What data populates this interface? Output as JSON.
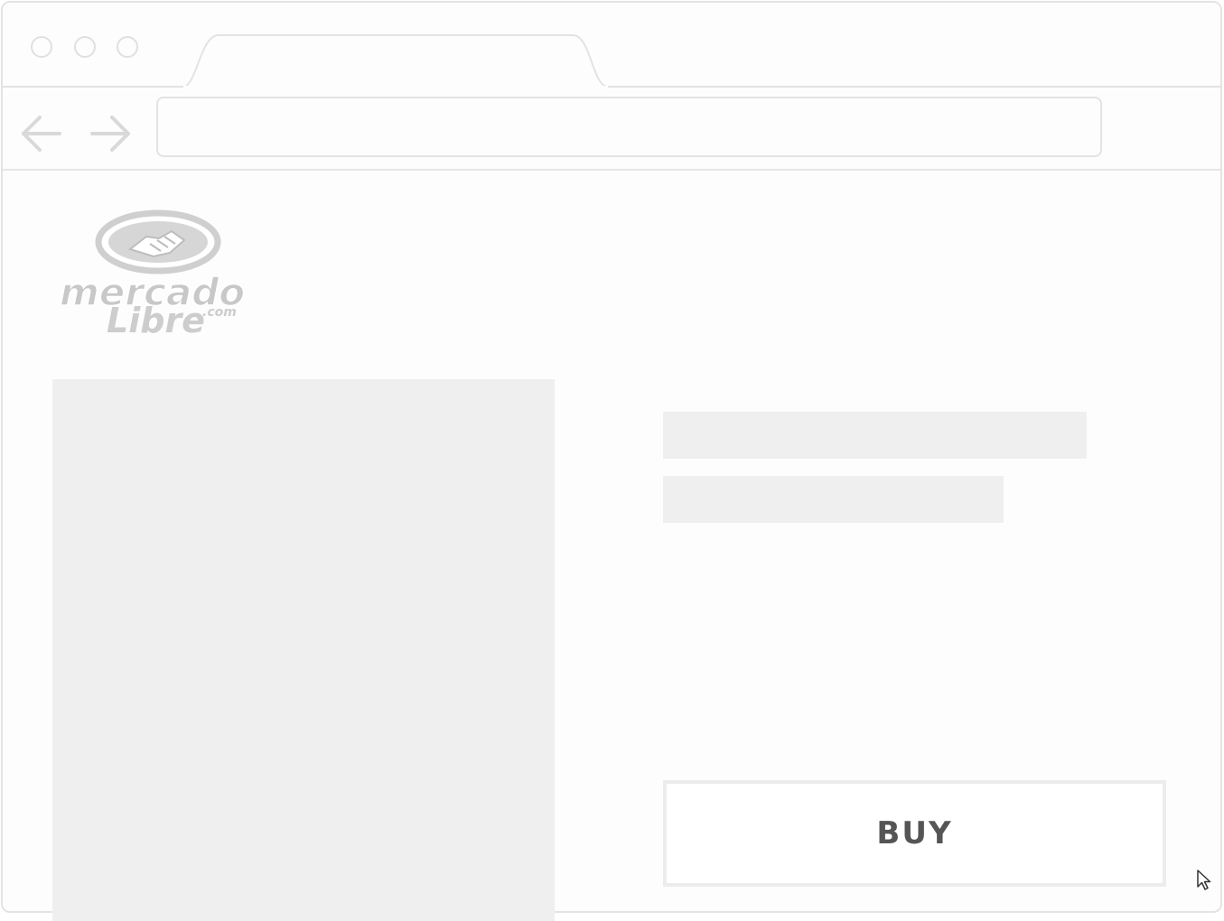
{
  "browser": {
    "controls": [
      "close",
      "minimize",
      "maximize"
    ],
    "back_icon": "arrow-left-icon",
    "forward_icon": "arrow-right-icon",
    "address_value": ""
  },
  "logo": {
    "word1": "mercado",
    "word2": "Libre",
    "suffix": ".com",
    "emblem": "handshake-icon"
  },
  "product": {
    "buy_label": "BUY"
  },
  "colors": {
    "chrome_border": "#e3e3e3",
    "placeholder": "#efefef",
    "logo_gray": "#c8c8c8",
    "button_text": "#555555"
  }
}
